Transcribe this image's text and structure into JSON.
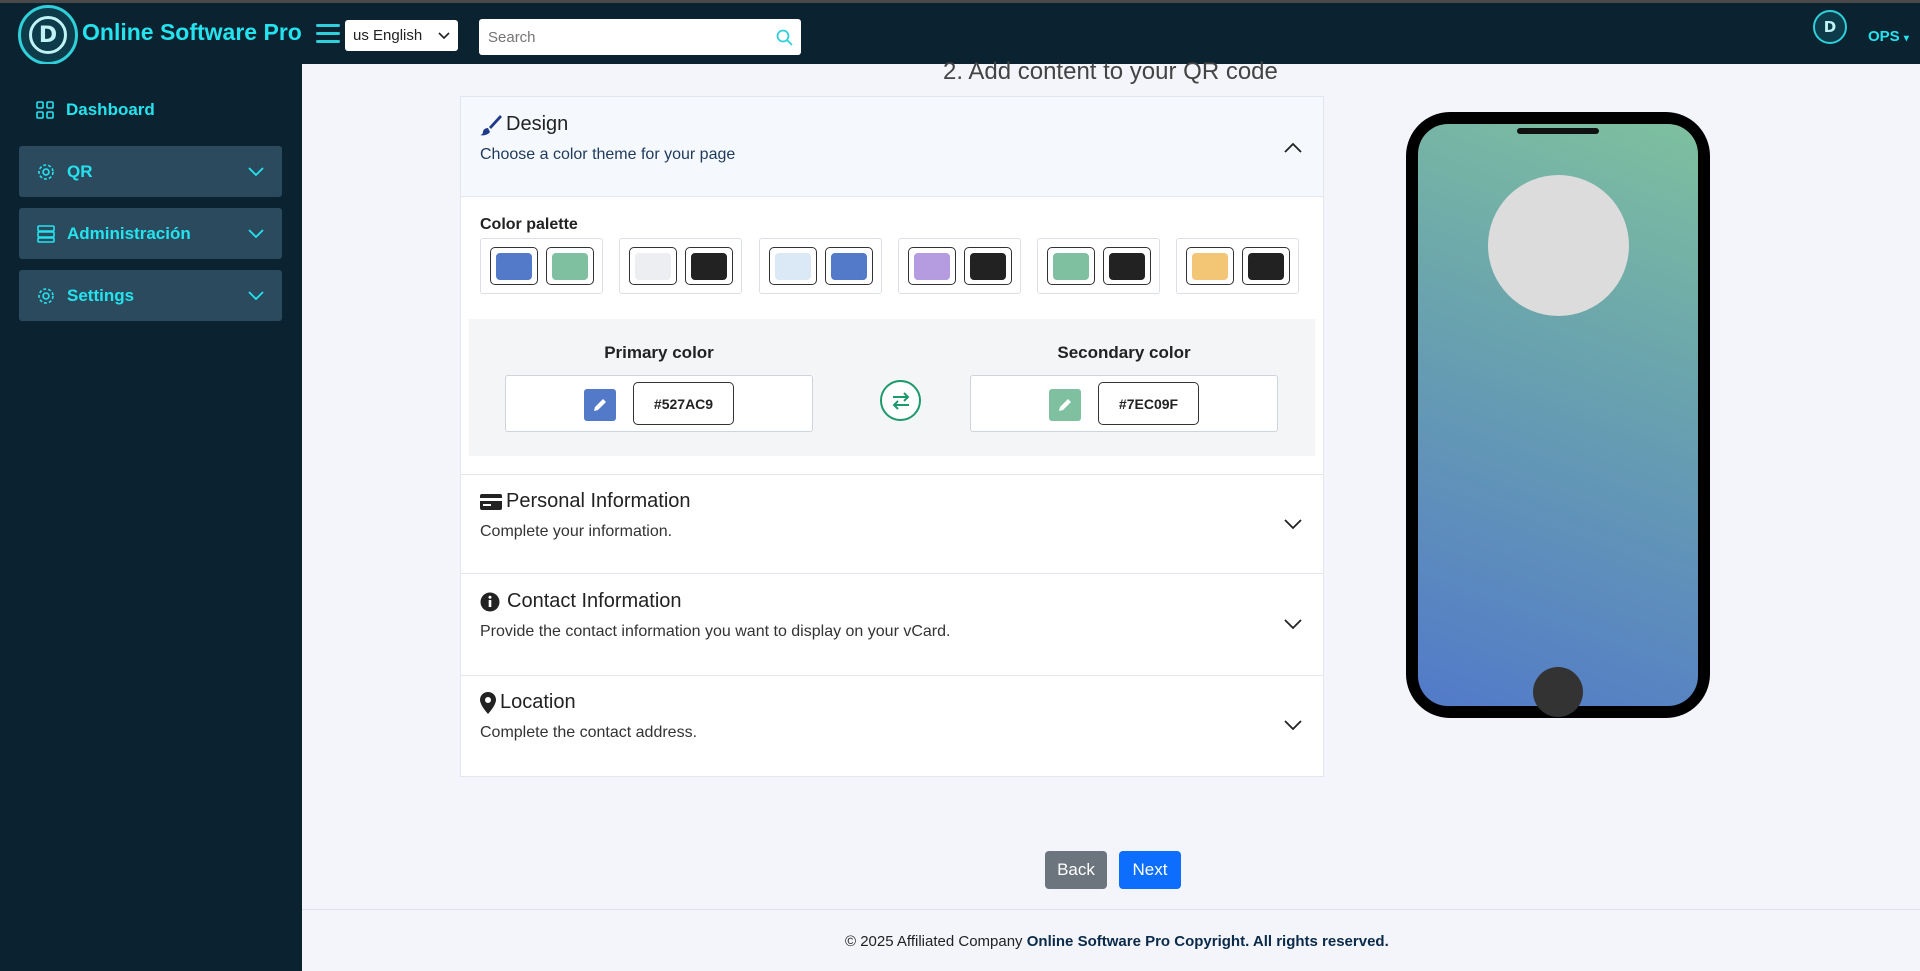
{
  "header": {
    "brand": "Online Software Pro",
    "language": "us English",
    "search_placeholder": "Search",
    "user": "OPS",
    "logo_letter": "D"
  },
  "sidebar": {
    "dashboard": "Dashboard",
    "groups": [
      {
        "label": "QR"
      },
      {
        "label": "Administración"
      },
      {
        "label": "Settings"
      }
    ]
  },
  "main": {
    "step_title": "2. Add content to your QR code",
    "design": {
      "title": "Design",
      "subtitle": "Choose a color theme for your page",
      "palette_label": "Color palette",
      "palettes": [
        {
          "a": "#527ac9",
          "b": "#7ec09f"
        },
        {
          "a": "#eceef2",
          "b": "#222222"
        },
        {
          "a": "#dbe8f5",
          "b": "#527ac9"
        },
        {
          "a": "#b59ce0",
          "b": "#222222"
        },
        {
          "a": "#7ec09f",
          "b": "#222222"
        },
        {
          "a": "#f2c675",
          "b": "#222222"
        }
      ],
      "primary_label": "Primary color",
      "primary_value": "#527AC9",
      "secondary_label": "Secondary color",
      "secondary_value": "#7EC09F"
    },
    "personal": {
      "title": "Personal Information",
      "subtitle": "Complete your information."
    },
    "contact": {
      "title": "Contact Information",
      "subtitle": "Provide the contact information you want to display on your vCard."
    },
    "location": {
      "title": "Location",
      "subtitle": "Complete the contact address."
    },
    "back_label": "Back",
    "next_label": "Next"
  },
  "footer": {
    "prefix": "© 2025 Affiliated Company",
    "bold": "Online Software Pro Copyright. All rights reserved."
  },
  "colors": {
    "accent": "#25e3ee",
    "dark": "#0b2230",
    "primary": "#527ac9",
    "secondary": "#7ec09f",
    "next": "#0d6efd",
    "back": "#6c757d"
  }
}
